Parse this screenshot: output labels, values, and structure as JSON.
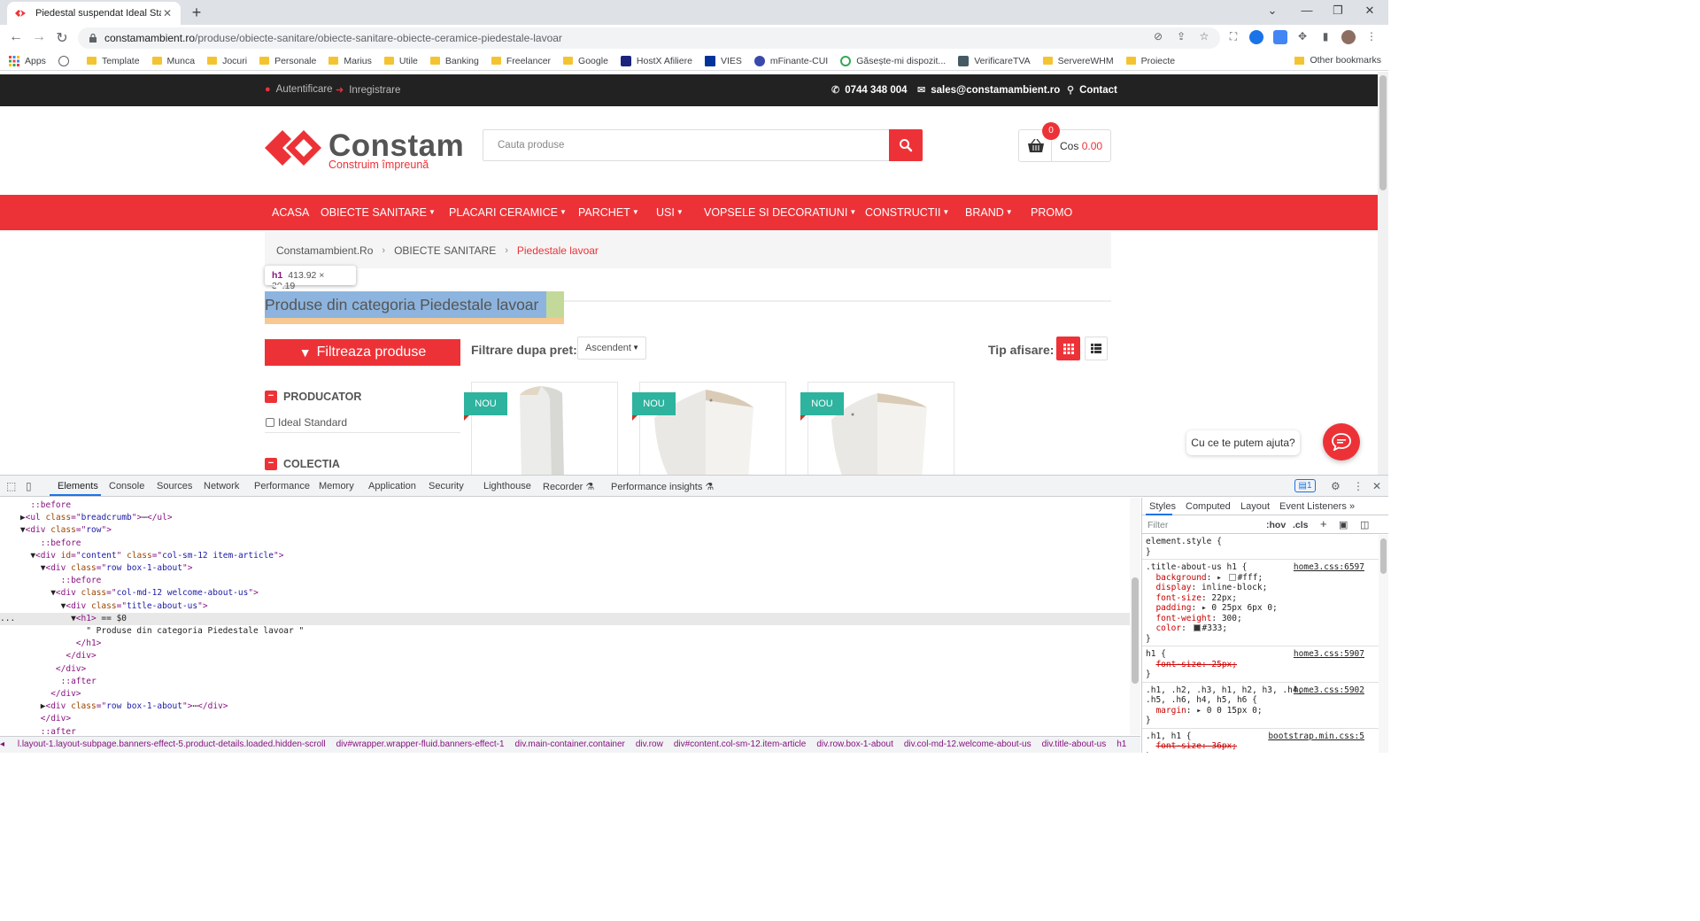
{
  "browser": {
    "tab_title": "Piedestal suspendat Ideal Standa",
    "url_domain": "constamambient.ro",
    "url_path": "/produse/obiecte-sanitare/obiecte-sanitare-obiecte-ceramice-piedestale-lavoar",
    "bookmarks": [
      "Apps",
      "Template",
      "Munca",
      "Jocuri",
      "Personale",
      "Marius",
      "Utile",
      "Banking",
      "Freelancer",
      "Google",
      "HostX Afiliere",
      "VIES",
      "mFinante-CUI",
      "Găsește-mi dispozit...",
      "VerificareTVA",
      "ServereWHM",
      "Proiecte"
    ],
    "other_bookmarks": "Other bookmarks"
  },
  "site": {
    "topbar": {
      "login": "Autentificare",
      "register": "Inregistrare",
      "phone": "0744 348 004",
      "email": "sales@constamambient.ro",
      "contact": "Contact"
    },
    "logo": {
      "name": "Constam",
      "tagline": "Construim împreună"
    },
    "search": {
      "placeholder": "Cauta produse"
    },
    "cart": {
      "count": "0",
      "label": "Cos",
      "amount": "0.00"
    },
    "nav": [
      "ACASA",
      "OBIECTE SANITARE",
      "PLACARI CERAMICE",
      "PARCHET",
      "USI",
      "VOPSELE SI DECORATIUNI",
      "CONSTRUCTII",
      "BRAND",
      "PROMO"
    ],
    "breadcrumb": [
      "Constamambient.Ro",
      "OBIECTE SANITARE",
      "Piedestale lavoar"
    ],
    "inspector_tooltip": {
      "tag": "h1",
      "dims": "413.92 × 30.19"
    },
    "heading": "Produse din categoria Piedestale lavoar",
    "filter_button": "Filtreaza produse",
    "price_filter_label": "Filtrare dupa pret:",
    "sort_value": "Ascendent",
    "view_label": "Tip afisare:",
    "facets": {
      "producer": "PRODUCATOR",
      "producer_option": "Ideal Standard",
      "collection": "COLECTIA"
    },
    "product_badge": "NOU",
    "chat_prompt": "Cu ce te putem ajuta?",
    "colors": {
      "brand": "#ed3237",
      "badge": "#2db39e",
      "topbar": "#222222"
    }
  },
  "devtools": {
    "tabs": [
      "Elements",
      "Console",
      "Sources",
      "Network",
      "Performance",
      "Memory",
      "Application",
      "Security",
      "Lighthouse",
      "Recorder",
      "Performance insights"
    ],
    "issues_count": "1",
    "dom_lines": [
      {
        "pre": "      ",
        "pe": "::before"
      },
      {
        "pre": "    ▶",
        "open": "<ul",
        "attrs": [
          [
            "class",
            "breadcrumb"
          ]
        ],
        "tail": ">",
        "ellipsis": "⋯",
        "close": "</ul>"
      },
      {
        "pre": "    ▼",
        "open": "<div",
        "attrs": [
          [
            "class",
            "row"
          ]
        ],
        "tail": ">"
      },
      {
        "pre": "        ",
        "pe": "::before"
      },
      {
        "pre": "      ▼",
        "open": "<div",
        "attrs": [
          [
            "id",
            "content"
          ],
          [
            "class",
            "col-sm-12 item-article"
          ]
        ],
        "tail": ">"
      },
      {
        "pre": "        ▼",
        "open": "<div",
        "attrs": [
          [
            "class",
            "row box-1-about"
          ]
        ],
        "tail": ">"
      },
      {
        "pre": "            ",
        "pe": "::before"
      },
      {
        "pre": "          ▼",
        "open": "<div",
        "attrs": [
          [
            "class",
            "col-md-12 welcome-about-us"
          ]
        ],
        "tail": ">"
      },
      {
        "pre": "            ▼",
        "open": "<div",
        "attrs": [
          [
            "class",
            "title-about-us"
          ]
        ],
        "tail": ">"
      },
      {
        "pre": "...           ▼",
        "open": "<h1>",
        "eq": " == $0",
        "selected": true
      },
      {
        "pre": "                 ",
        "text": "\" Produse din categoria Piedestale lavoar \""
      },
      {
        "pre": "               ",
        "close": "</h1>"
      },
      {
        "pre": "             ",
        "close": "</div>"
      },
      {
        "pre": "           ",
        "close": "</div>"
      },
      {
        "pre": "            ",
        "pe": "::after"
      },
      {
        "pre": "          ",
        "close": "</div>"
      },
      {
        "pre": "        ▶",
        "open": "<div",
        "attrs": [
          [
            "class",
            "row box-1-about"
          ]
        ],
        "tail": ">",
        "ellipsis": "⋯",
        "close": "</div>"
      },
      {
        "pre": "        ",
        "close": "</div>"
      },
      {
        "pre": "        ",
        "pe": "::after"
      }
    ],
    "crumb_path": [
      "l.layout-1.layout-subpage.banners-effect-5.product-details.loaded.hidden-scroll",
      "div#wrapper.wrapper-fluid.banners-effect-1",
      "div.main-container.container",
      "div.row",
      "div#content.col-sm-12.item-article",
      "div.row.box-1-about",
      "div.col-md-12.welcome-about-us",
      "div.title-about-us",
      "h1"
    ],
    "styles_tabs": [
      "Styles",
      "Computed",
      "Layout",
      "Event Listeners"
    ],
    "filter_placeholder": "Filter",
    "hov": ":hov",
    "cls": ".cls",
    "rules": [
      {
        "selector": "element.style {",
        "source": "",
        "props": []
      },
      {
        "selector": ".title-about-us h1 {",
        "source": "home3.css:6597",
        "props": [
          {
            "name": "background",
            "value": "#fff;",
            "swatch": "#ffffff",
            "arrow": true
          },
          {
            "name": "display",
            "value": "inline-block;"
          },
          {
            "name": "font-size",
            "value": "22px;"
          },
          {
            "name": "padding",
            "value": "0 25px 6px 0;",
            "arrow": true
          },
          {
            "name": "font-weight",
            "value": "300;"
          },
          {
            "name": "color",
            "value": "#333;",
            "swatch": "#333333"
          }
        ]
      },
      {
        "selector": "h1 {",
        "source": "home3.css:5907",
        "props": [
          {
            "name": "font-size",
            "value": "25px;",
            "struck": true
          }
        ]
      },
      {
        "selector": ".h1, .h2, .h3, h1, h2, h3, .h4,",
        "selector2": ".h5, .h6, h4, h5, h6 {",
        "source": "home3.css:5902",
        "props": [
          {
            "name": "margin",
            "value": "0 0 15px 0;",
            "arrow": true
          }
        ]
      },
      {
        "selector": ".h1, h1 {",
        "source": "bootstrap.min.css:5",
        "props": [
          {
            "name": "font-size",
            "value": "36px;",
            "struck": true
          }
        ]
      }
    ]
  }
}
